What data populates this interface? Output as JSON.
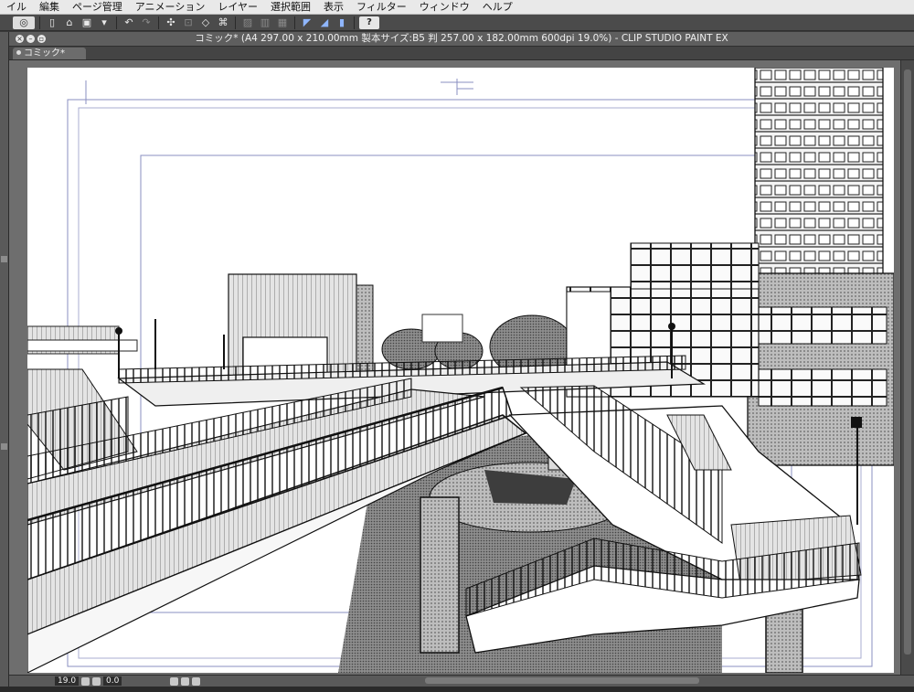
{
  "menu": {
    "items": [
      "イル",
      "編集",
      "ページ管理",
      "アニメーション",
      "レイヤー",
      "選択範囲",
      "表示",
      "フィルター",
      "ウィンドウ",
      "ヘルプ"
    ]
  },
  "toolbar": {
    "help_label": "?"
  },
  "window": {
    "title": "コミック* (A4 297.00 x 210.00mm 製本サイズ:B5 判 257.00 x 182.00mm 600dpi 19.0%)  - CLIP STUDIO PAINT EX"
  },
  "tab": {
    "label": "コミック*"
  },
  "status": {
    "zoom": "19.0",
    "rotation": "0.0"
  },
  "colors": {
    "menubar_bg": "#e9e9e9",
    "toolbar_bg": "#4b4b4b",
    "titlebar_bg": "#5e5e5e",
    "canvas_bg": "#6e6e6e",
    "paper": "#ffffff",
    "guide_lines": "#8a8fc0"
  },
  "canvas": {
    "description_icon": "manga-artwork-canvas"
  }
}
